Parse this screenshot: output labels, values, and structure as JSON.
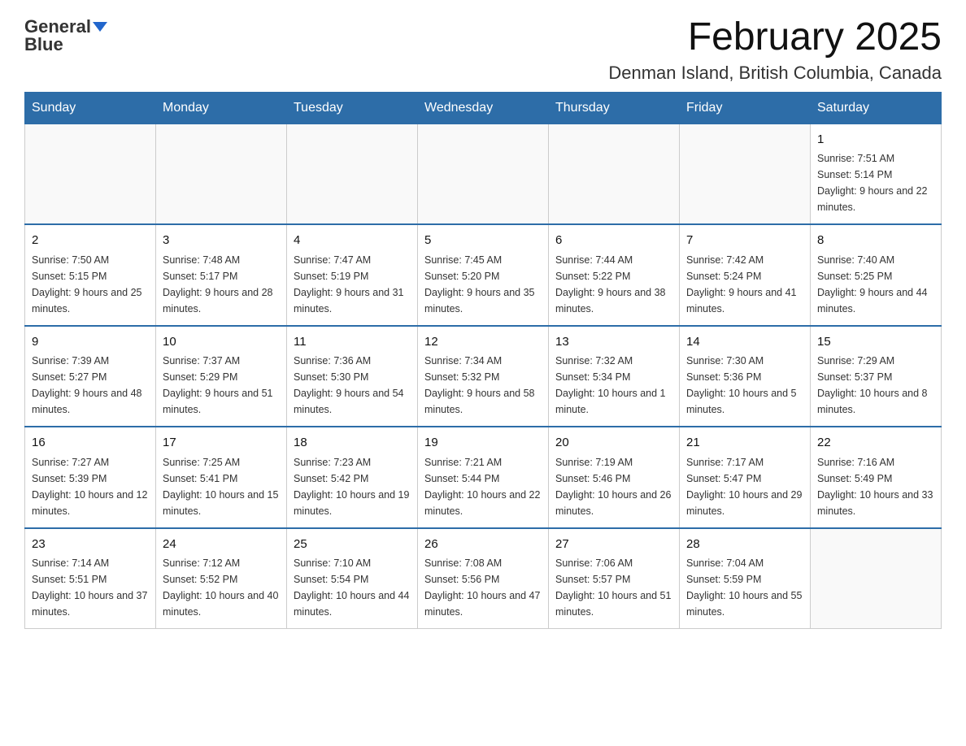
{
  "header": {
    "logo_text_general": "General",
    "logo_text_blue": "Blue",
    "month_title": "February 2025",
    "location": "Denman Island, British Columbia, Canada"
  },
  "weekdays": [
    "Sunday",
    "Monday",
    "Tuesday",
    "Wednesday",
    "Thursday",
    "Friday",
    "Saturday"
  ],
  "weeks": [
    [
      {
        "day": "",
        "info": ""
      },
      {
        "day": "",
        "info": ""
      },
      {
        "day": "",
        "info": ""
      },
      {
        "day": "",
        "info": ""
      },
      {
        "day": "",
        "info": ""
      },
      {
        "day": "",
        "info": ""
      },
      {
        "day": "1",
        "info": "Sunrise: 7:51 AM\nSunset: 5:14 PM\nDaylight: 9 hours and 22 minutes."
      }
    ],
    [
      {
        "day": "2",
        "info": "Sunrise: 7:50 AM\nSunset: 5:15 PM\nDaylight: 9 hours and 25 minutes."
      },
      {
        "day": "3",
        "info": "Sunrise: 7:48 AM\nSunset: 5:17 PM\nDaylight: 9 hours and 28 minutes."
      },
      {
        "day": "4",
        "info": "Sunrise: 7:47 AM\nSunset: 5:19 PM\nDaylight: 9 hours and 31 minutes."
      },
      {
        "day": "5",
        "info": "Sunrise: 7:45 AM\nSunset: 5:20 PM\nDaylight: 9 hours and 35 minutes."
      },
      {
        "day": "6",
        "info": "Sunrise: 7:44 AM\nSunset: 5:22 PM\nDaylight: 9 hours and 38 minutes."
      },
      {
        "day": "7",
        "info": "Sunrise: 7:42 AM\nSunset: 5:24 PM\nDaylight: 9 hours and 41 minutes."
      },
      {
        "day": "8",
        "info": "Sunrise: 7:40 AM\nSunset: 5:25 PM\nDaylight: 9 hours and 44 minutes."
      }
    ],
    [
      {
        "day": "9",
        "info": "Sunrise: 7:39 AM\nSunset: 5:27 PM\nDaylight: 9 hours and 48 minutes."
      },
      {
        "day": "10",
        "info": "Sunrise: 7:37 AM\nSunset: 5:29 PM\nDaylight: 9 hours and 51 minutes."
      },
      {
        "day": "11",
        "info": "Sunrise: 7:36 AM\nSunset: 5:30 PM\nDaylight: 9 hours and 54 minutes."
      },
      {
        "day": "12",
        "info": "Sunrise: 7:34 AM\nSunset: 5:32 PM\nDaylight: 9 hours and 58 minutes."
      },
      {
        "day": "13",
        "info": "Sunrise: 7:32 AM\nSunset: 5:34 PM\nDaylight: 10 hours and 1 minute."
      },
      {
        "day": "14",
        "info": "Sunrise: 7:30 AM\nSunset: 5:36 PM\nDaylight: 10 hours and 5 minutes."
      },
      {
        "day": "15",
        "info": "Sunrise: 7:29 AM\nSunset: 5:37 PM\nDaylight: 10 hours and 8 minutes."
      }
    ],
    [
      {
        "day": "16",
        "info": "Sunrise: 7:27 AM\nSunset: 5:39 PM\nDaylight: 10 hours and 12 minutes."
      },
      {
        "day": "17",
        "info": "Sunrise: 7:25 AM\nSunset: 5:41 PM\nDaylight: 10 hours and 15 minutes."
      },
      {
        "day": "18",
        "info": "Sunrise: 7:23 AM\nSunset: 5:42 PM\nDaylight: 10 hours and 19 minutes."
      },
      {
        "day": "19",
        "info": "Sunrise: 7:21 AM\nSunset: 5:44 PM\nDaylight: 10 hours and 22 minutes."
      },
      {
        "day": "20",
        "info": "Sunrise: 7:19 AM\nSunset: 5:46 PM\nDaylight: 10 hours and 26 minutes."
      },
      {
        "day": "21",
        "info": "Sunrise: 7:17 AM\nSunset: 5:47 PM\nDaylight: 10 hours and 29 minutes."
      },
      {
        "day": "22",
        "info": "Sunrise: 7:16 AM\nSunset: 5:49 PM\nDaylight: 10 hours and 33 minutes."
      }
    ],
    [
      {
        "day": "23",
        "info": "Sunrise: 7:14 AM\nSunset: 5:51 PM\nDaylight: 10 hours and 37 minutes."
      },
      {
        "day": "24",
        "info": "Sunrise: 7:12 AM\nSunset: 5:52 PM\nDaylight: 10 hours and 40 minutes."
      },
      {
        "day": "25",
        "info": "Sunrise: 7:10 AM\nSunset: 5:54 PM\nDaylight: 10 hours and 44 minutes."
      },
      {
        "day": "26",
        "info": "Sunrise: 7:08 AM\nSunset: 5:56 PM\nDaylight: 10 hours and 47 minutes."
      },
      {
        "day": "27",
        "info": "Sunrise: 7:06 AM\nSunset: 5:57 PM\nDaylight: 10 hours and 51 minutes."
      },
      {
        "day": "28",
        "info": "Sunrise: 7:04 AM\nSunset: 5:59 PM\nDaylight: 10 hours and 55 minutes."
      },
      {
        "day": "",
        "info": ""
      }
    ]
  ]
}
